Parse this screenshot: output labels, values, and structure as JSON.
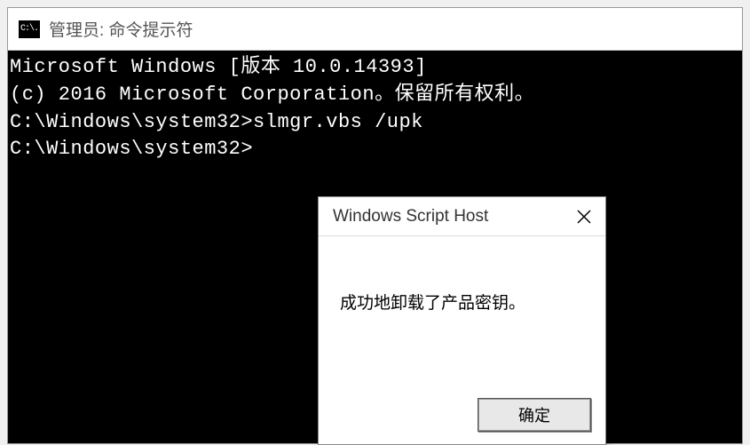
{
  "titlebar": {
    "icon_text": "C:\\.",
    "title": "管理员: 命令提示符"
  },
  "terminal": {
    "line1": "Microsoft Windows [版本 10.0.14393]",
    "line2": "(c) 2016 Microsoft Corporation。保留所有权利。",
    "line3": "",
    "line4": "C:\\Windows\\system32>slmgr.vbs /upk",
    "line5": "",
    "line6": "C:\\Windows\\system32>"
  },
  "dialog": {
    "title": "Windows Script Host",
    "message": "成功地卸载了产品密钥。",
    "ok_label": "确定"
  }
}
